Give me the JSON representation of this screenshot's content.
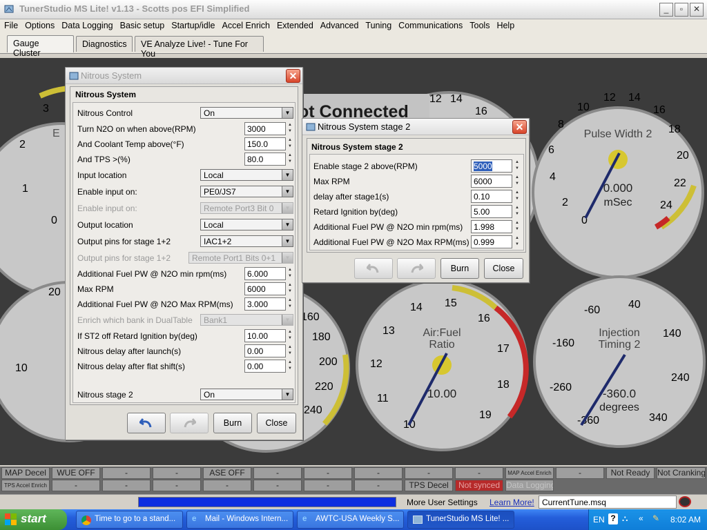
{
  "app": {
    "title": "TunerStudio MS Lite! v1.13 - Scotts pos EFI Simplified",
    "menu": [
      "File",
      "Options",
      "Data Logging",
      "Basic setup",
      "Startup/idle",
      "Accel Enrich",
      "Extended",
      "Advanced",
      "Tuning",
      "Communications",
      "Tools",
      "Help"
    ],
    "tabs": [
      "Gauge Cluster",
      "Diagnostics",
      "VE Analyze Live! - Tune For You"
    ],
    "active_tab": "Gauge Cluster"
  },
  "gauges": {
    "left_top_ticks": [
      "3",
      "2",
      "1",
      "0"
    ],
    "left_top_label_fragment": "E",
    "left_bottom_ticks": [
      "20",
      "10"
    ],
    "mid_bottom_ticks": [
      "160",
      "180",
      "200",
      "220",
      "240"
    ],
    "mid_top_ticks": [
      "12",
      "14",
      "16"
    ],
    "not_connected_text": "ot Connected",
    "pulse_width": {
      "ticks": [
        "10",
        "12",
        "14",
        "16",
        "18",
        "20",
        "22",
        "24",
        "8",
        "6",
        "4",
        "2",
        "0"
      ],
      "label": "Pulse Width 2",
      "value": "0.000",
      "unit": "mSec"
    },
    "air_fuel": {
      "ticks": [
        "14",
        "15",
        "16",
        "17",
        "18",
        "19",
        "13",
        "12",
        "11",
        "10"
      ],
      "label1": "Air:Fuel",
      "label2": "Ratio",
      "value": "10.00"
    },
    "injection_timing": {
      "ticks": [
        "-60",
        "40",
        "-160",
        "140",
        "-260",
        "240",
        "-360",
        "340"
      ],
      "label1": "Injection",
      "label2": "Timing 2",
      "value": "-360.0",
      "unit": "degrees"
    }
  },
  "indicators": {
    "row1": [
      "MAP Decel",
      "WUE OFF",
      "-",
      "-",
      "ASE OFF",
      "-",
      "-",
      "-",
      "-",
      "-",
      "MAP Accel Enrich",
      "-",
      "Not Ready",
      "Not Cranking"
    ],
    "row2": [
      "TPS Accel Enrich",
      "-",
      "-",
      "-",
      "-",
      "-",
      "-",
      "-",
      "TPS Decel",
      "Not synced",
      "Data Logging"
    ]
  },
  "bottom": {
    "more_settings": "More User Settings",
    "learn_more": "Learn More!",
    "tune_file": "CurrentTune.msq",
    "progress": 1.0
  },
  "nitrous": {
    "title": "Nitrous System",
    "group_title": "Nitrous System",
    "rows": {
      "nitrous_control": {
        "label": "Nitrous Control",
        "value": "On"
      },
      "turn_on_rpm": {
        "label": "Turn N2O on when above(RPM)",
        "value": "3000"
      },
      "coolant_temp": {
        "label": "And Coolant Temp above(°F)",
        "value": "150.0"
      },
      "tps": {
        "label": "And TPS >(%)",
        "value": "80.0"
      },
      "input_location": {
        "label": "Input location",
        "value": "Local"
      },
      "enable_input": {
        "label": "Enable input on:",
        "value": "PE0/JS7"
      },
      "enable_input_remote": {
        "label": "Enable input on:",
        "value": "Remote Port3 Bit 0"
      },
      "output_location": {
        "label": "Output location",
        "value": "Local"
      },
      "output_pins": {
        "label": "Output pins for stage 1+2",
        "value": "IAC1+2"
      },
      "output_pins_remote": {
        "label": "Output pins for stage 1+2",
        "value": "Remote Port1 Bits 0+1"
      },
      "fuel_pw_min": {
        "label": "Additional Fuel PW @ N2O min rpm(ms)",
        "value": "6.000"
      },
      "max_rpm": {
        "label": "Max RPM",
        "value": "6000"
      },
      "fuel_pw_max": {
        "label": "Additional Fuel PW @ N2O Max RPM(ms)",
        "value": "3.000"
      },
      "enrich_bank": {
        "label": "Enrich which bank in DualTable",
        "value": "Bank1"
      },
      "retard_ignition": {
        "label": "If ST2 off Retard Ignition by(deg)",
        "value": "10.00"
      },
      "delay_launch": {
        "label": "Nitrous delay after launch(s)",
        "value": "0.00"
      },
      "delay_flat_shift": {
        "label": "Nitrous delay after flat shift(s)",
        "value": "0.00"
      },
      "stage2": {
        "label": "Nitrous stage 2",
        "value": "On"
      }
    },
    "buttons": {
      "burn": "Burn",
      "close": "Close"
    }
  },
  "stage2": {
    "title": "Nitrous System stage 2",
    "group_title": "Nitrous System stage 2",
    "rows": {
      "enable_rpm": {
        "label": "Enable stage 2 above(RPM)",
        "value": "5000"
      },
      "max_rpm": {
        "label": "Max RPM",
        "value": "6000"
      },
      "delay": {
        "label": "delay after stage1(s)",
        "value": "0.10"
      },
      "retard": {
        "label": "Retard Ignition by(deg)",
        "value": "5.00"
      },
      "fuel_min": {
        "label": "Additional Fuel PW @ N2O min rpm(ms)",
        "value": "1.998"
      },
      "fuel_max": {
        "label": "Additional Fuel PW @ N2O Max RPM(ms)",
        "value": "0.999"
      }
    },
    "buttons": {
      "burn": "Burn",
      "close": "Close"
    }
  },
  "taskbar": {
    "start": "start",
    "tasks": [
      "Time to go to a stand...",
      "Mail - Windows Intern...",
      "AWTC-USA Weekly S...",
      "TunerStudio MS Lite! ..."
    ],
    "lang": "EN",
    "time": "8:02 AM"
  },
  "colors": {
    "dialog_bg": "#e1dfd9",
    "dash_bg": "#3b3b3b",
    "needle": "#1e2a6b",
    "redline": "#c62828",
    "yellowband": "#cdbf36"
  }
}
